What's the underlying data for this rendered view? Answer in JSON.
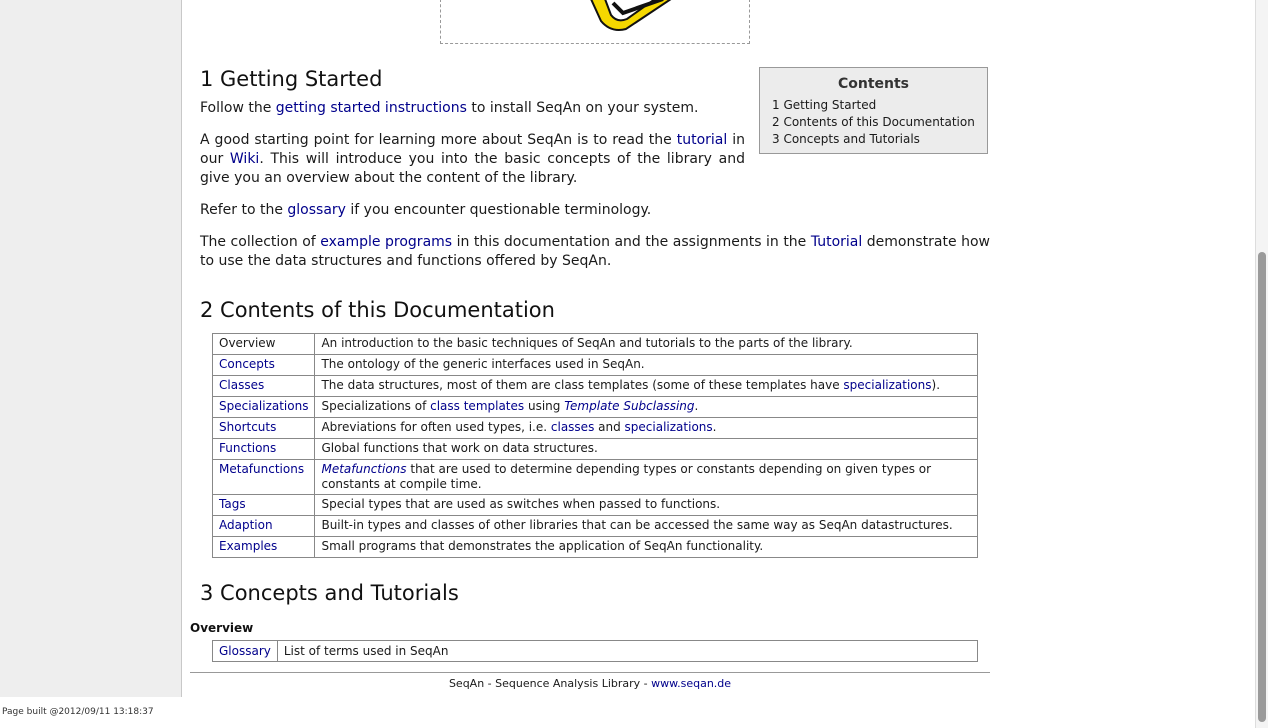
{
  "page_built": "Page built @2012/09/11 13:18:37",
  "section1": {
    "heading": "1 Getting Started",
    "p1": {
      "pre": "Follow the ",
      "link": "getting started instructions",
      "post": " to install SeqAn on your system."
    },
    "p2": {
      "pre": "A good starting point for learning more about SeqAn is to read the ",
      "link1": "tutorial",
      "mid": " in our ",
      "link2": "Wiki",
      "post": ". This will introduce you into the basic concepts of the library and give you an overview about the content of the library."
    },
    "p3": {
      "pre": "Refer to the ",
      "link": "glossary",
      "post": " if you encounter questionable terminology."
    },
    "p4": {
      "pre": "The collection of ",
      "link1": "example programs",
      "mid": " in this documentation and the assignments in the ",
      "link2": "Tutorial",
      "post": " demonstrate how to use the data structures and functions offered by SeqAn."
    }
  },
  "toc": {
    "title": "Contents",
    "items": [
      "1 Getting Started",
      "2 Contents of this Documentation",
      "3 Concepts and Tutorials"
    ]
  },
  "section2": {
    "heading": "2 Contents of this Documentation",
    "rows": {
      "overview": {
        "key": "Overview",
        "desc": "An introduction to the basic techniques of SeqAn and tutorials to the parts of the library."
      },
      "concepts": {
        "key": "Concepts",
        "desc": "The ontology of the generic interfaces used in SeqAn."
      },
      "classes": {
        "key": "Classes",
        "desc_pre": "The data structures, most of them are class templates (some of these templates have ",
        "desc_link": "specializations",
        "desc_post": ")."
      },
      "specializations": {
        "key": "Specializations",
        "desc_pre": "Specializations of ",
        "desc_link": "class templates",
        "desc_mid": " using ",
        "desc_em": "Template Subclassing",
        "desc_post": "."
      },
      "shortcuts": {
        "key": "Shortcuts",
        "desc_pre": "Abreviations for often used types, i.e. ",
        "desc_link1": "classes",
        "desc_mid": " and ",
        "desc_link2": "specializations",
        "desc_post": "."
      },
      "functions": {
        "key": "Functions",
        "desc": "Global functions that work on data structures."
      },
      "metafunctions": {
        "key": "Metafunctions",
        "desc_em": "Metafunctions",
        "desc_post": " that are used to determine depending types or constants depending on given types or constants at compile time."
      },
      "tags": {
        "key": "Tags",
        "desc": "Special types that are used as switches when passed to functions."
      },
      "adaption": {
        "key": "Adaption",
        "desc": "Built-in types and classes of other libraries that can be accessed the same way as SeqAn datastructures."
      },
      "examples": {
        "key": "Examples",
        "desc": "Small programs that demonstrates the application of SeqAn functionality."
      }
    }
  },
  "section3": {
    "heading": "3 Concepts and Tutorials",
    "subheading": "Overview",
    "glossary": {
      "key": "Glossary",
      "desc": "List of terms used in SeqAn"
    }
  },
  "footer": {
    "text": "SeqAn - Sequence Analysis Library - ",
    "link": "www.seqan.de"
  },
  "colors": {
    "link": "#00008b",
    "sidebar_bg": "#eeeeee",
    "toc_bg": "#ececec",
    "logo_yellow": "#f5d800"
  }
}
